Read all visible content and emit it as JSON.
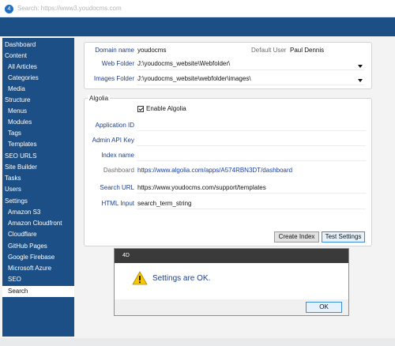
{
  "window": {
    "title": "Search: https://www3.youdocms.com",
    "app_icon": "4d-app-icon"
  },
  "sidebar": {
    "items": [
      {
        "label": "Dashboard",
        "sub": false
      },
      {
        "label": "Content",
        "sub": false
      },
      {
        "label": "All Articles",
        "sub": true
      },
      {
        "label": "Categories",
        "sub": true
      },
      {
        "label": "Media",
        "sub": true
      },
      {
        "label": "Structure",
        "sub": false
      },
      {
        "label": "Menus",
        "sub": true
      },
      {
        "label": "Modules",
        "sub": true
      },
      {
        "label": "Tags",
        "sub": true
      },
      {
        "label": "Templates",
        "sub": true
      },
      {
        "label": "SEO URLS",
        "sub": false
      },
      {
        "label": "Site Builder",
        "sub": false
      },
      {
        "label": "Tasks",
        "sub": false
      },
      {
        "label": "Users",
        "sub": false
      },
      {
        "label": "Settings",
        "sub": false
      },
      {
        "label": "Amazon S3",
        "sub": true
      },
      {
        "label": "Amazon Cloudfront",
        "sub": true
      },
      {
        "label": "Cloudflare",
        "sub": true
      },
      {
        "label": "GitHub Pages",
        "sub": true
      },
      {
        "label": "Google Firebase",
        "sub": true
      },
      {
        "label": "Microsoft Azure",
        "sub": true
      },
      {
        "label": "SEO",
        "sub": true
      },
      {
        "label": "Search",
        "sub": true,
        "active": true
      }
    ]
  },
  "site": {
    "domain_label": "Domain name",
    "domain_value": "youdocms",
    "default_user_label": "Default User",
    "default_user_value": "Paul Dennis",
    "web_folder_label": "Web Folder",
    "web_folder_value": "J:\\youdocms_website\\Webfolder\\",
    "images_folder_label": "Images Folder",
    "images_folder_value": "J:\\youdocms_website\\webfolder\\images\\"
  },
  "algolia": {
    "section_title": "Algolia",
    "enable_label": "Enable Algolia",
    "enabled": true,
    "application_id_label": "Application ID",
    "application_id_value": "",
    "admin_api_key_label": "Admin API Key",
    "admin_api_key_value": "",
    "index_name_label": "Index name",
    "index_name_value": "",
    "dashboard_label": "Dashboard",
    "dashboard_url": "https://www.algolia.com/apps/A574RBN3DT/dashboard",
    "search_url_label": "Search URL",
    "search_url_value": "https://www.youdocms.com/support/templates",
    "html_input_label": "HTML Input",
    "html_input_value": "search_term_string",
    "create_index_label": "Create Index",
    "test_settings_label": "Test Settings"
  },
  "dialog": {
    "title": "4D",
    "message": "Settings are OK.",
    "ok_label": "OK",
    "icon": "warning-icon"
  },
  "colors": {
    "sidebar_bg": "#1c4f85",
    "banner_bg": "#1c4f85",
    "label_blue": "#1e3f8a",
    "link_blue": "#1a3fa8",
    "warning_yellow": "#f7c600"
  }
}
